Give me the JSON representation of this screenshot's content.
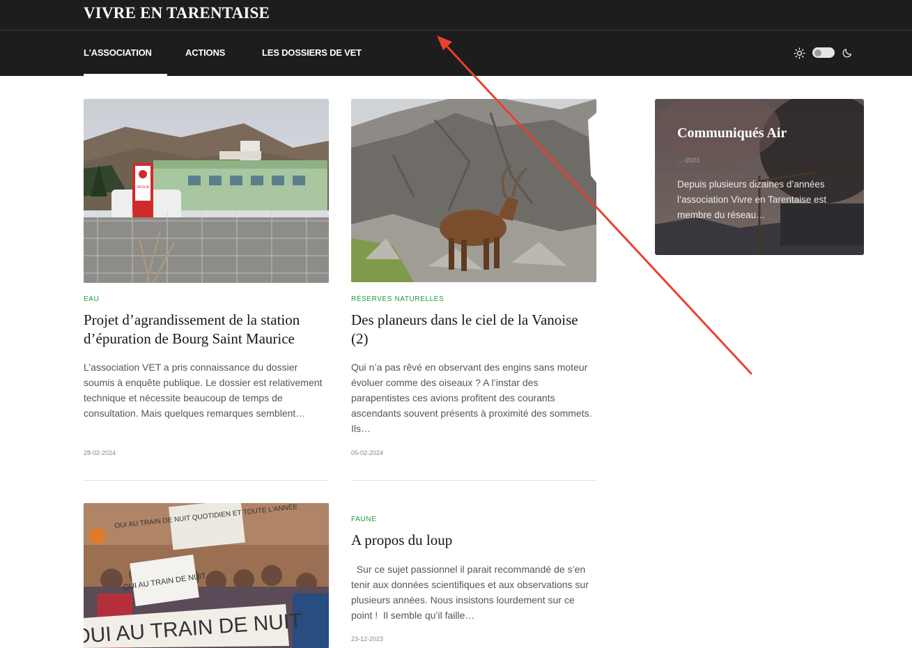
{
  "site": {
    "title": "VIVRE EN TARENTAISE"
  },
  "nav": {
    "items": [
      {
        "label": "L'ASSOCIATION"
      },
      {
        "label": "ACTIONS"
      },
      {
        "label": "LES DOSSIERS DE VET"
      }
    ],
    "active_index": 0
  },
  "theme": {
    "icons": [
      "sun-icon",
      "moon-icon"
    ],
    "dark_mode": false
  },
  "posts": [
    {
      "category": "EAU",
      "title": "Projet d’agrandissement de la station d’épuration de Bourg Saint Maurice",
      "excerpt": "L’association VET a pris connaissance du dossier soumis à enquête publique. Le dossier est relativement technique et nécessite beaucoup de temps de consultation. Mais quelques remarques semblent…",
      "date": "28-02-2024"
    },
    {
      "category": "RÉSERVES NATURELLES",
      "title": "Des planeurs dans le ciel de la Vanoise (2)",
      "excerpt": "Qui n’a pas rêvé en observant des engins sans moteur évoluer comme des oiseaux ? A l’instar des parapentistes ces avions profitent des courants ascendants souvent présents à proximité des sommets. Ils…",
      "date": "05-02-2024"
    },
    {
      "category": "FAUNE",
      "title": "A propos du loup",
      "excerpt": "  Sur ce sujet passionnel il parait recommandé de s’en tenir aux données scientifiques et aux observations sur plusieurs années. Nous insistons lourdement sur ce point !  Il semble qu’il faille…",
      "date": "23-12-2023"
    }
  ],
  "images": {
    "post1": "station building with VEOLIA sign",
    "post2": "ibex on rocky mountain",
    "post3": "demonstrators with OUI AU TRAIN DE NUIT banners",
    "sidebar": "smoke over mountain town"
  },
  "image_text": {
    "veolia_sign": "VEOLIA",
    "banner_top": "OUI AU TRAIN DE NUIT QUOTIDIEN ET TOUTE L'ANNÉE",
    "banner_sign": "OUI AU TRAIN DE NUIT",
    "banner_bottom": "OUI AU TRAIN DE NUIT"
  },
  "sidebar": {
    "card": {
      "title": "Communiqués Air",
      "date": "…-2023",
      "excerpt": "Depuis plusieurs dizaines d’années l’association Vivre en Tarentaise est membre du réseau…"
    }
  },
  "colors": {
    "header_bg": "#1d1d1d",
    "category": "#1a9a3a",
    "annotation_arrow": "#e8412f"
  }
}
